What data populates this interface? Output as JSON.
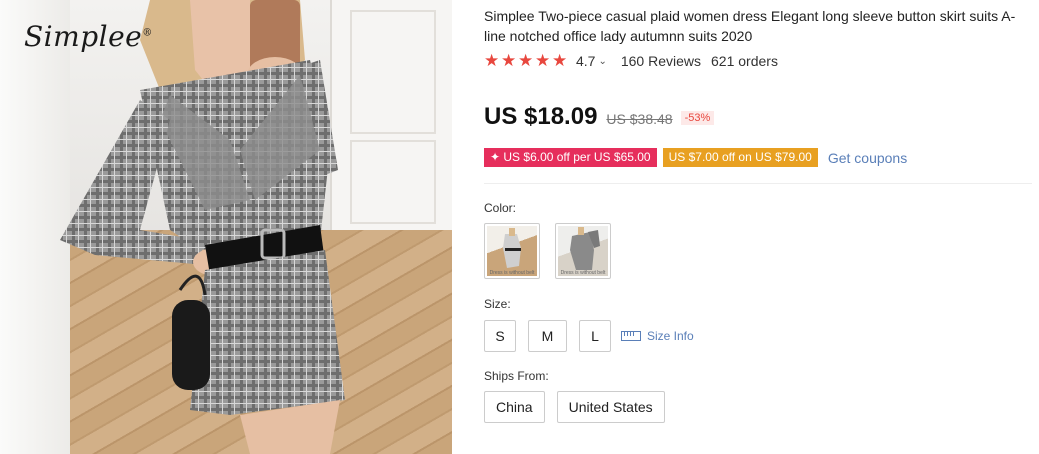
{
  "brand": {
    "logo_text": "Simplee",
    "logo_mark": "®"
  },
  "product": {
    "title": "Simplee Two-piece casual plaid women dress Elegant long sleeve button skirt suits A-line notched office lady autumnn suits 2020",
    "rating": "4.7",
    "rating_chevron": "⌄",
    "stars": 5,
    "reviews": "160 Reviews",
    "orders": "621 orders",
    "price": "US $18.09",
    "old_price": "US $38.48",
    "discount": "-53%"
  },
  "coupons": {
    "store_coupon": "✦ US $6.00 off per US $65.00",
    "select_coupon": "US $7.00 off on US $79.00",
    "get_coupons": "Get coupons"
  },
  "color": {
    "label": "Color:",
    "options": [
      {
        "caption": "Dress is without belt"
      },
      {
        "caption": "Dress is without belt"
      }
    ]
  },
  "size": {
    "label": "Size:",
    "options": [
      "S",
      "M",
      "L"
    ],
    "size_info": "Size Info"
  },
  "ships_from": {
    "label": "Ships From:",
    "options": [
      "China",
      "United States"
    ]
  },
  "colors": {
    "accent_red": "#e8473e",
    "coupon_red": "#e62e5c",
    "coupon_orange": "#e8a021",
    "link_blue": "#5a7fb8"
  }
}
